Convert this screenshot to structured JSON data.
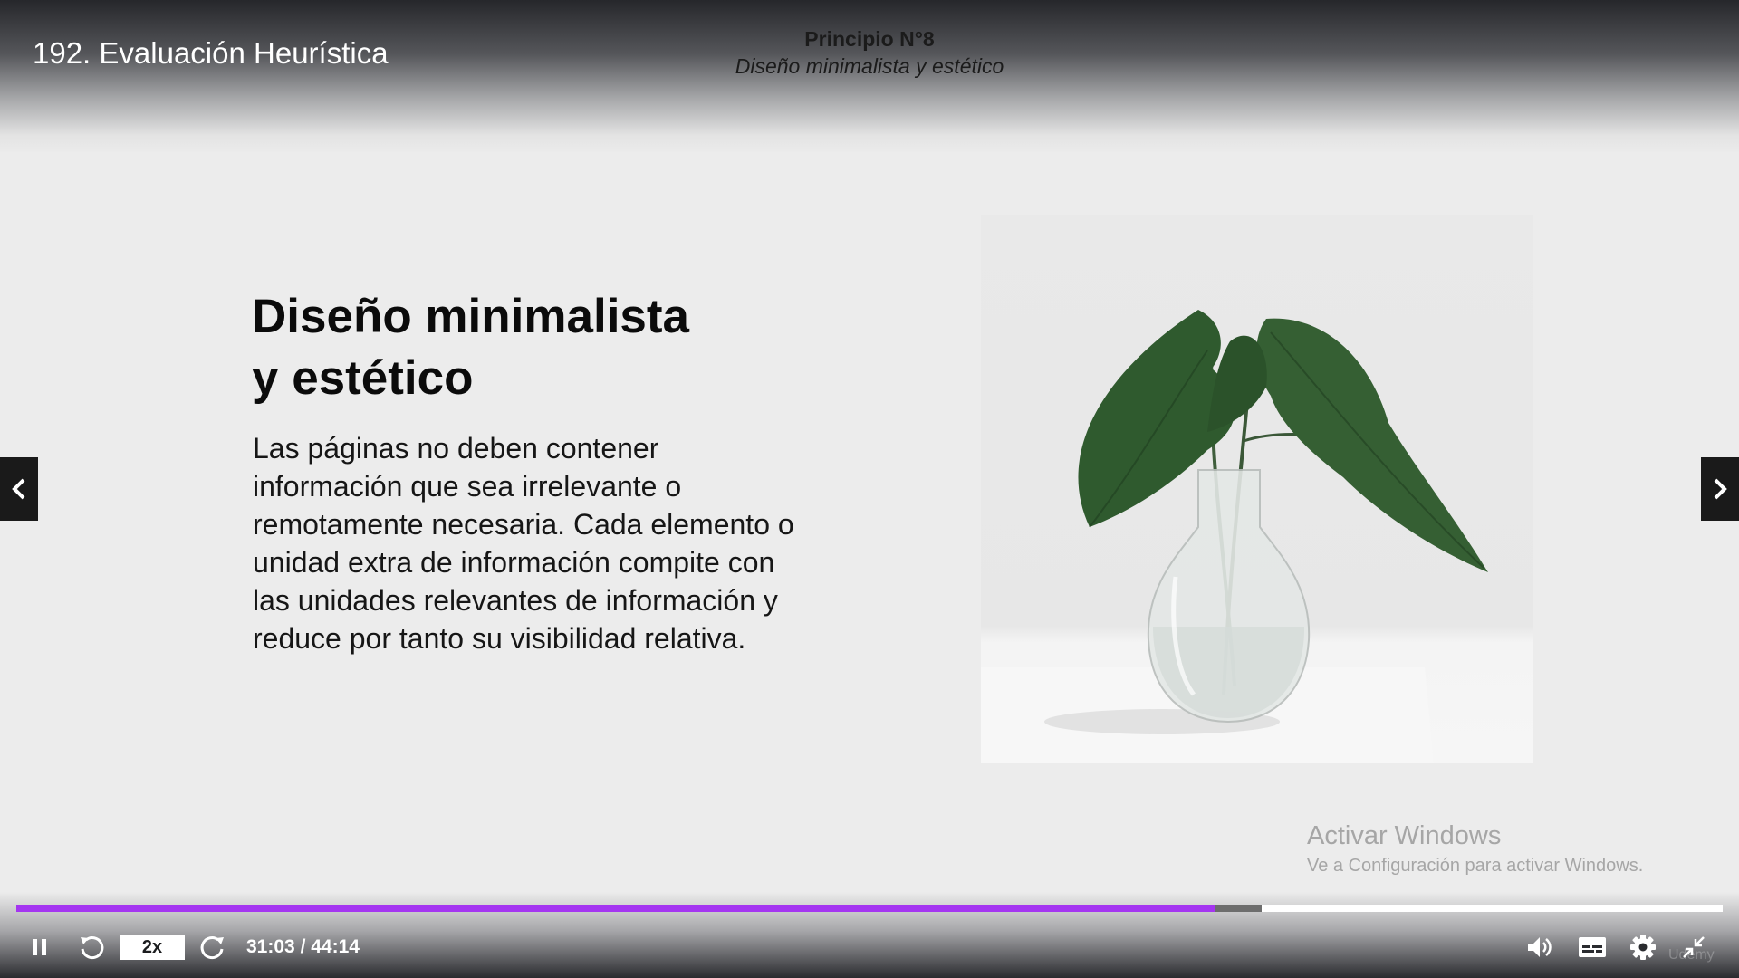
{
  "player": {
    "lecture_title": "192. Evaluación Heurística",
    "progress_played_fraction": 0.7025,
    "progress_buffered_fraction": 0.73,
    "speed_label": "2x",
    "time_current": "31:03",
    "time_separator": "/",
    "time_total": "44:14",
    "accent_color": "#a435f0",
    "brand": "Udemy"
  },
  "slide": {
    "principle": "Principio N°8",
    "subtitle": "Diseño minimalista y estético",
    "heading_line1": "Diseño minimalista",
    "heading_line2": "y estético",
    "body": "Las páginas no deben contener información que sea irrelevante o remotamente necesaria. Cada elemento o unidad extra de información compite con las unidades relevantes de información y reduce por tanto su visibilidad relativa.",
    "image_subject": "plant-leaves-in-glass-vase"
  },
  "watermark": {
    "title": "Activar Windows",
    "subtitle": "Ve a Configuración para activar Windows."
  },
  "icons": {
    "prev": "chevron-left-icon",
    "next": "chevron-right-icon",
    "pause": "pause-icon",
    "rewind": "rewind-icon",
    "forward": "forward-icon",
    "volume": "volume-icon",
    "captions": "captions-icon",
    "settings": "gear-icon",
    "fullscreen": "exit-fullscreen-icon"
  }
}
